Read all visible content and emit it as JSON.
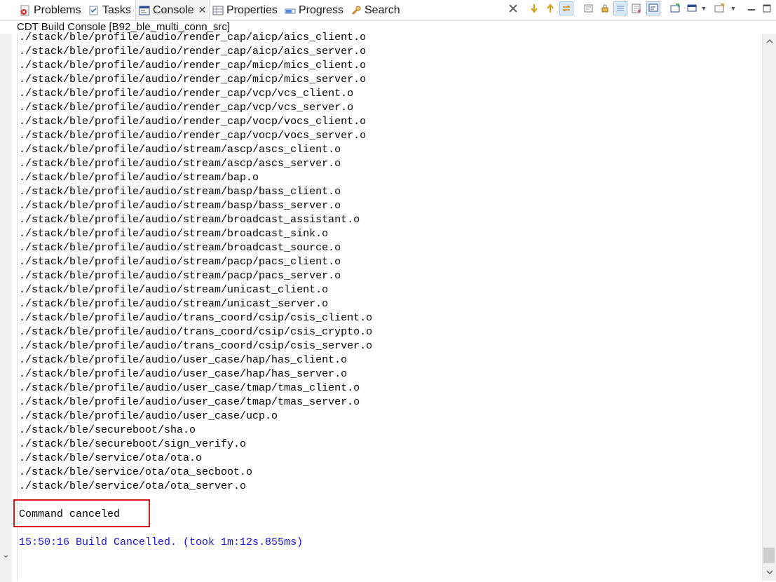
{
  "tabs": [
    {
      "label": "Problems",
      "icon": "problems-icon"
    },
    {
      "label": "Tasks",
      "icon": "tasks-icon"
    },
    {
      "label": "Console",
      "icon": "console-icon"
    },
    {
      "label": "Properties",
      "icon": "properties-icon"
    },
    {
      "label": "Progress",
      "icon": "progress-icon"
    },
    {
      "label": "Search",
      "icon": "search-icon"
    }
  ],
  "console_title": "CDT Build Console [B92_ble_multi_conn_src]",
  "output_lines": [
    "./stack/ble/profile/audio/render_cap/aicp/aics_client.o",
    "./stack/ble/profile/audio/render_cap/aicp/aics_server.o",
    "./stack/ble/profile/audio/render_cap/micp/mics_client.o",
    "./stack/ble/profile/audio/render_cap/micp/mics_server.o",
    "./stack/ble/profile/audio/render_cap/vcp/vcs_client.o",
    "./stack/ble/profile/audio/render_cap/vcp/vcs_server.o",
    "./stack/ble/profile/audio/render_cap/vocp/vocs_client.o",
    "./stack/ble/profile/audio/render_cap/vocp/vocs_server.o",
    "./stack/ble/profile/audio/stream/ascp/ascs_client.o",
    "./stack/ble/profile/audio/stream/ascp/ascs_server.o",
    "./stack/ble/profile/audio/stream/bap.o",
    "./stack/ble/profile/audio/stream/basp/bass_client.o",
    "./stack/ble/profile/audio/stream/basp/bass_server.o",
    "./stack/ble/profile/audio/stream/broadcast_assistant.o",
    "./stack/ble/profile/audio/stream/broadcast_sink.o",
    "./stack/ble/profile/audio/stream/broadcast_source.o",
    "./stack/ble/profile/audio/stream/pacp/pacs_client.o",
    "./stack/ble/profile/audio/stream/pacp/pacs_server.o",
    "./stack/ble/profile/audio/stream/unicast_client.o",
    "./stack/ble/profile/audio/stream/unicast_server.o",
    "./stack/ble/profile/audio/trans_coord/csip/csis_client.o",
    "./stack/ble/profile/audio/trans_coord/csip/csis_crypto.o",
    "./stack/ble/profile/audio/trans_coord/csip/csis_server.o",
    "./stack/ble/profile/audio/user_case/hap/has_client.o",
    "./stack/ble/profile/audio/user_case/hap/has_server.o",
    "./stack/ble/profile/audio/user_case/tmap/tmas_client.o",
    "./stack/ble/profile/audio/user_case/tmap/tmas_server.o",
    "./stack/ble/profile/audio/user_case/ucp.o",
    "./stack/ble/secureboot/sha.o",
    "./stack/ble/secureboot/sign_verify.o",
    "./stack/ble/service/ota/ota.o",
    "./stack/ble/service/ota/ota_secboot.o",
    "./stack/ble/service/ota/ota_server.o"
  ],
  "command_status": "Command canceled",
  "build_status": "15:50:16 Build Cancelled. (took 1m:12s.855ms)",
  "toolbar_icons": [
    "clear-console-icon",
    "next-icon",
    "previous-icon",
    "link-icon",
    "scroll-lock-icon",
    "pin-icon",
    "show-on-output-icon",
    "word-wrap-icon",
    "display-selected-console-icon",
    "open-console-icon",
    "dropdown-icon",
    "new-console-view-icon",
    "dropdown-icon",
    "minimize-icon",
    "dropdown-icon"
  ],
  "colors": {
    "output_text": "#000000",
    "build_status_text": "#1919d9",
    "highlight_box": "#d8171f",
    "active_tab_bg": "#f3f3f3"
  }
}
